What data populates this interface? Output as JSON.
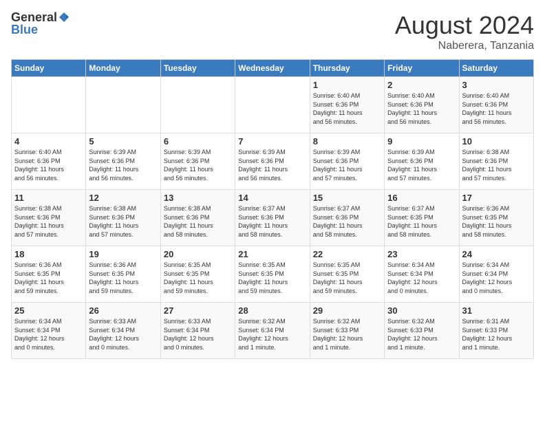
{
  "header": {
    "logo_general": "General",
    "logo_blue": "Blue",
    "title": "August 2024",
    "subtitle": "Naberera, Tanzania"
  },
  "calendar": {
    "weekdays": [
      "Sunday",
      "Monday",
      "Tuesday",
      "Wednesday",
      "Thursday",
      "Friday",
      "Saturday"
    ],
    "weeks": [
      [
        {
          "day": "",
          "info": ""
        },
        {
          "day": "",
          "info": ""
        },
        {
          "day": "",
          "info": ""
        },
        {
          "day": "",
          "info": ""
        },
        {
          "day": "1",
          "info": "Sunrise: 6:40 AM\nSunset: 6:36 PM\nDaylight: 11 hours\nand 56 minutes."
        },
        {
          "day": "2",
          "info": "Sunrise: 6:40 AM\nSunset: 6:36 PM\nDaylight: 11 hours\nand 56 minutes."
        },
        {
          "day": "3",
          "info": "Sunrise: 6:40 AM\nSunset: 6:36 PM\nDaylight: 11 hours\nand 56 minutes."
        }
      ],
      [
        {
          "day": "4",
          "info": "Sunrise: 6:40 AM\nSunset: 6:36 PM\nDaylight: 11 hours\nand 56 minutes."
        },
        {
          "day": "5",
          "info": "Sunrise: 6:39 AM\nSunset: 6:36 PM\nDaylight: 11 hours\nand 56 minutes."
        },
        {
          "day": "6",
          "info": "Sunrise: 6:39 AM\nSunset: 6:36 PM\nDaylight: 11 hours\nand 56 minutes."
        },
        {
          "day": "7",
          "info": "Sunrise: 6:39 AM\nSunset: 6:36 PM\nDaylight: 11 hours\nand 56 minutes."
        },
        {
          "day": "8",
          "info": "Sunrise: 6:39 AM\nSunset: 6:36 PM\nDaylight: 11 hours\nand 57 minutes."
        },
        {
          "day": "9",
          "info": "Sunrise: 6:39 AM\nSunset: 6:36 PM\nDaylight: 11 hours\nand 57 minutes."
        },
        {
          "day": "10",
          "info": "Sunrise: 6:38 AM\nSunset: 6:36 PM\nDaylight: 11 hours\nand 57 minutes."
        }
      ],
      [
        {
          "day": "11",
          "info": "Sunrise: 6:38 AM\nSunset: 6:36 PM\nDaylight: 11 hours\nand 57 minutes."
        },
        {
          "day": "12",
          "info": "Sunrise: 6:38 AM\nSunset: 6:36 PM\nDaylight: 11 hours\nand 57 minutes."
        },
        {
          "day": "13",
          "info": "Sunrise: 6:38 AM\nSunset: 6:36 PM\nDaylight: 11 hours\nand 58 minutes."
        },
        {
          "day": "14",
          "info": "Sunrise: 6:37 AM\nSunset: 6:36 PM\nDaylight: 11 hours\nand 58 minutes."
        },
        {
          "day": "15",
          "info": "Sunrise: 6:37 AM\nSunset: 6:36 PM\nDaylight: 11 hours\nand 58 minutes."
        },
        {
          "day": "16",
          "info": "Sunrise: 6:37 AM\nSunset: 6:35 PM\nDaylight: 11 hours\nand 58 minutes."
        },
        {
          "day": "17",
          "info": "Sunrise: 6:36 AM\nSunset: 6:35 PM\nDaylight: 11 hours\nand 58 minutes."
        }
      ],
      [
        {
          "day": "18",
          "info": "Sunrise: 6:36 AM\nSunset: 6:35 PM\nDaylight: 11 hours\nand 59 minutes."
        },
        {
          "day": "19",
          "info": "Sunrise: 6:36 AM\nSunset: 6:35 PM\nDaylight: 11 hours\nand 59 minutes."
        },
        {
          "day": "20",
          "info": "Sunrise: 6:35 AM\nSunset: 6:35 PM\nDaylight: 11 hours\nand 59 minutes."
        },
        {
          "day": "21",
          "info": "Sunrise: 6:35 AM\nSunset: 6:35 PM\nDaylight: 11 hours\nand 59 minutes."
        },
        {
          "day": "22",
          "info": "Sunrise: 6:35 AM\nSunset: 6:35 PM\nDaylight: 11 hours\nand 59 minutes."
        },
        {
          "day": "23",
          "info": "Sunrise: 6:34 AM\nSunset: 6:34 PM\nDaylight: 12 hours\nand 0 minutes."
        },
        {
          "day": "24",
          "info": "Sunrise: 6:34 AM\nSunset: 6:34 PM\nDaylight: 12 hours\nand 0 minutes."
        }
      ],
      [
        {
          "day": "25",
          "info": "Sunrise: 6:34 AM\nSunset: 6:34 PM\nDaylight: 12 hours\nand 0 minutes."
        },
        {
          "day": "26",
          "info": "Sunrise: 6:33 AM\nSunset: 6:34 PM\nDaylight: 12 hours\nand 0 minutes."
        },
        {
          "day": "27",
          "info": "Sunrise: 6:33 AM\nSunset: 6:34 PM\nDaylight: 12 hours\nand 0 minutes."
        },
        {
          "day": "28",
          "info": "Sunrise: 6:32 AM\nSunset: 6:34 PM\nDaylight: 12 hours\nand 1 minute."
        },
        {
          "day": "29",
          "info": "Sunrise: 6:32 AM\nSunset: 6:33 PM\nDaylight: 12 hours\nand 1 minute."
        },
        {
          "day": "30",
          "info": "Sunrise: 6:32 AM\nSunset: 6:33 PM\nDaylight: 12 hours\nand 1 minute."
        },
        {
          "day": "31",
          "info": "Sunrise: 6:31 AM\nSunset: 6:33 PM\nDaylight: 12 hours\nand 1 minute."
        }
      ]
    ]
  }
}
